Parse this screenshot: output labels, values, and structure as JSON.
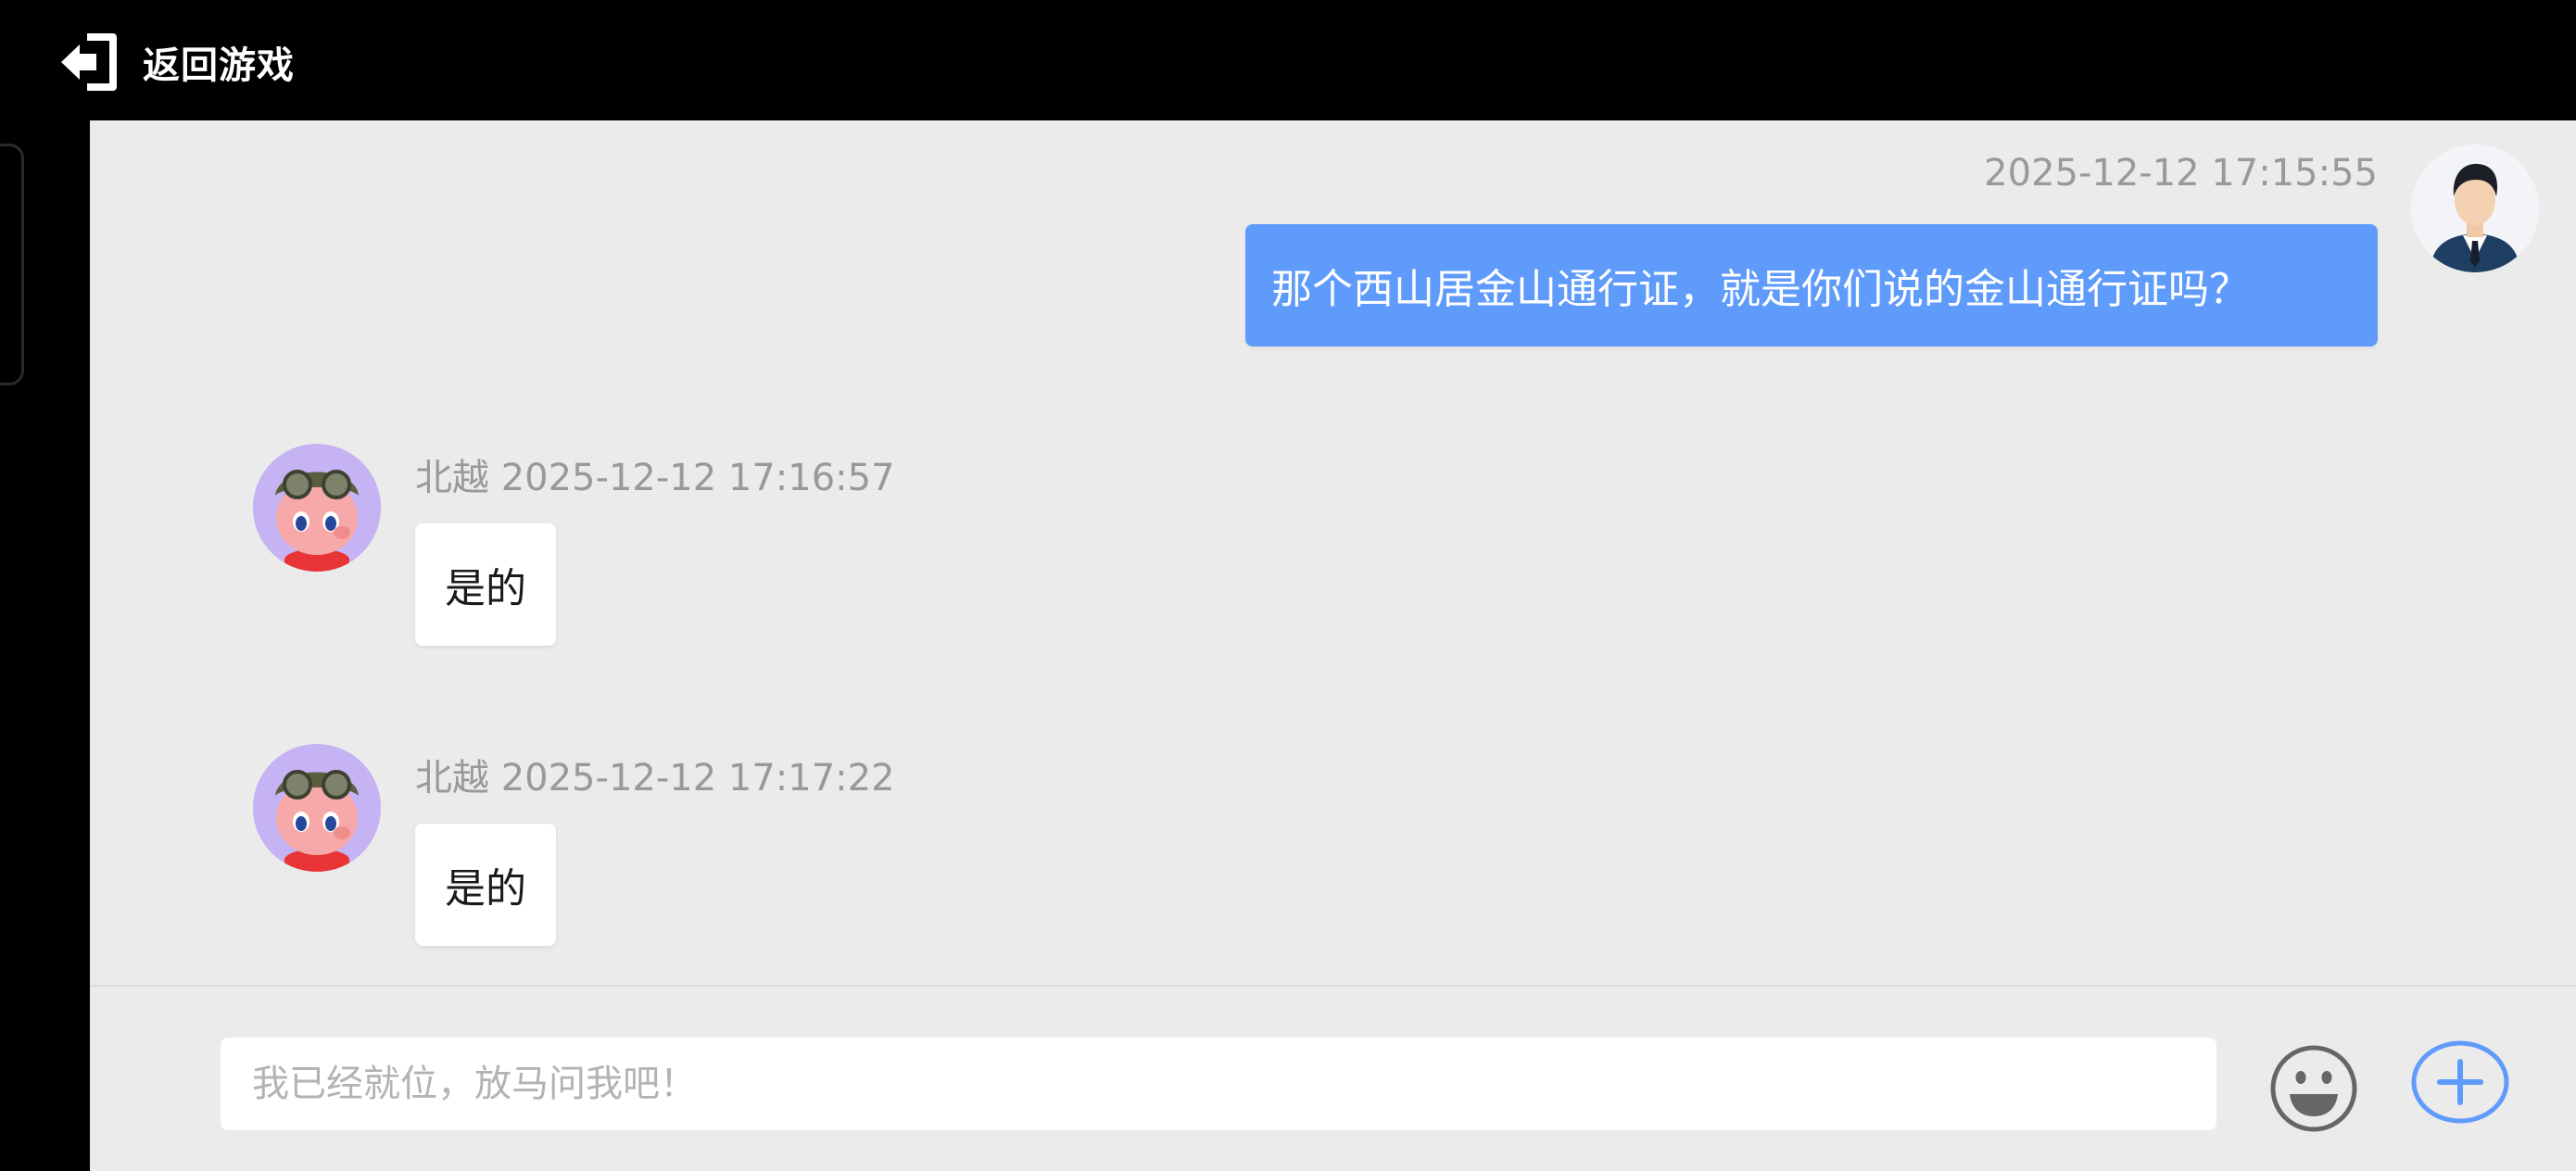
{
  "header": {
    "back_label": "返回游戏",
    "back_icon": "exit-arrow-icon"
  },
  "messages": [
    {
      "sender": "self",
      "time": "2025-12-12 17:15:55",
      "text": "那个西山居金山通行证，就是你们说的金山通行证吗？",
      "avatar": "user-avatar-businessman"
    },
    {
      "sender": "bot",
      "name": "北越",
      "time": "2025-12-12 17:16:57",
      "meta": "北越 2025-12-12 17:16:57",
      "text": "是的",
      "avatar": "bot-avatar-pig-pilot"
    },
    {
      "sender": "bot",
      "name": "北越",
      "time": "2025-12-12 17:17:22",
      "meta": "北越 2025-12-12 17:17:22",
      "text": "是的",
      "avatar": "bot-avatar-pig-pilot"
    }
  ],
  "input": {
    "placeholder": "我已经就位，放马问我吧！",
    "value": ""
  },
  "actions": {
    "emoji_icon": "smiley-face-icon",
    "plus_icon": "plus-circle-icon"
  },
  "colors": {
    "own_bubble": "#5f9bfb",
    "chat_background": "#ebebeb",
    "meta_text": "#999999",
    "accent_plus": "#5f9bfb"
  }
}
